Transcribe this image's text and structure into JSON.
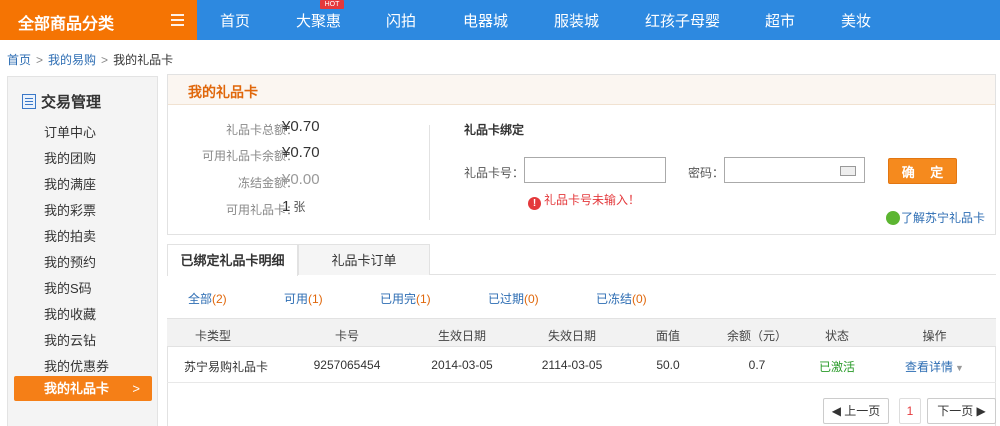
{
  "nav": {
    "category_label": "全部商品分类",
    "items": [
      "首页",
      "大聚惠",
      "闪拍",
      "电器城",
      "服装城",
      "红孩子母婴",
      "超市",
      "美妆"
    ],
    "hot_badge": "HOT"
  },
  "breadcrumb": {
    "home": "首页",
    "parent": "我的易购",
    "current": "我的礼品卡",
    "separator": ">"
  },
  "sidebar": {
    "title": "交易管理",
    "items": [
      "订单中心",
      "我的团购",
      "我的满座",
      "我的彩票",
      "我的拍卖",
      "我的预约",
      "我的S码",
      "我的收藏",
      "我的云钻",
      "我的优惠券",
      "我的礼品卡"
    ],
    "active_chevron": ">"
  },
  "panel": {
    "title": "我的礼品卡",
    "summary": [
      {
        "label": "礼品卡总额：",
        "value": "¥0.70"
      },
      {
        "label": "可用礼品卡余额：",
        "value": "¥0.70"
      },
      {
        "label": "冻结金额：",
        "value": "¥0.00"
      },
      {
        "label": "可用礼品卡：",
        "value": "1",
        "unit": "张"
      }
    ],
    "bind": {
      "title": "礼品卡绑定",
      "card_label": "礼品卡号：",
      "card_value": "",
      "password_label": "密码：",
      "password_value": "",
      "ok_label": "确 定",
      "error": "礼品卡号未输入！",
      "learn_more": "了解苏宁礼品卡"
    }
  },
  "tabs": [
    "已绑定礼品卡明细",
    "礼品卡订单"
  ],
  "filters": [
    {
      "label": "全部",
      "count": "(2)"
    },
    {
      "label": "可用",
      "count": "(1)"
    },
    {
      "label": "已用完",
      "count": "(1)"
    },
    {
      "label": "已过期",
      "count": "(0)"
    },
    {
      "label": "已冻结",
      "count": "(0)"
    }
  ],
  "table": {
    "headers": [
      "卡类型",
      "卡号",
      "生效日期",
      "失效日期",
      "面值",
      "余额（元）",
      "状态",
      "操作"
    ],
    "rows": [
      [
        "苏宁易购礼品卡",
        "9257065454",
        "2014-03-05",
        "2114-03-05",
        "50.0",
        "0.7",
        "已激活",
        "查看详情"
      ]
    ]
  },
  "pagination": {
    "prev": "上一页",
    "current": "1",
    "next": "下一页"
  },
  "colors": {
    "nav_blue": "#2d89e0",
    "accent_orange": "#f57403",
    "status_green": "#2a9b2a",
    "link_blue": "#2d6db3"
  }
}
